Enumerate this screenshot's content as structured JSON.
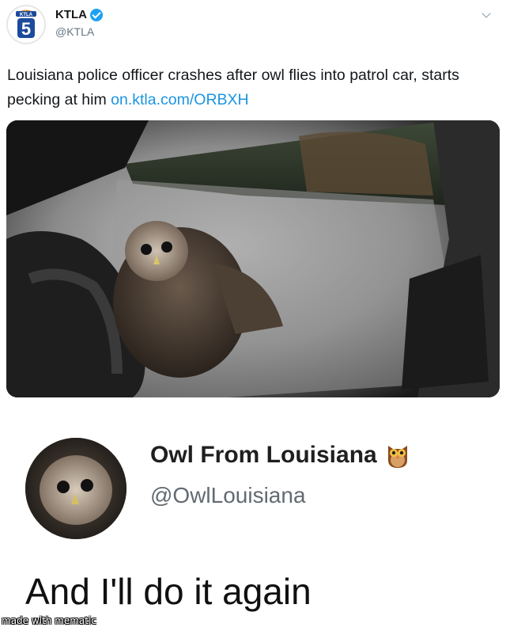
{
  "tweet": {
    "author_name": "KTLA",
    "author_handle": "@KTLA",
    "text": "Louisiana police officer crashes after owl flies into patrol car, starts pecking at him ",
    "link": "on.ktla.com/ORBXH",
    "avatar_channel_number": "5",
    "avatar_logo_text": "KTLA",
    "icons": [
      "ktla-logo",
      "verified-badge-icon",
      "caret-down-icon"
    ]
  },
  "reply": {
    "display_name": "Owl From Louisiana",
    "handle": "@OwlLouisiana",
    "text": "And I'll do it again",
    "icons": [
      "owl-emoji-icon"
    ]
  },
  "watermark": "made with mematic",
  "colors": {
    "link_blue": "#1b95e0",
    "verified_blue": "#1da1f2",
    "ktla_blue": "#1c4a9c",
    "ktla_orange": "#f08a24"
  }
}
